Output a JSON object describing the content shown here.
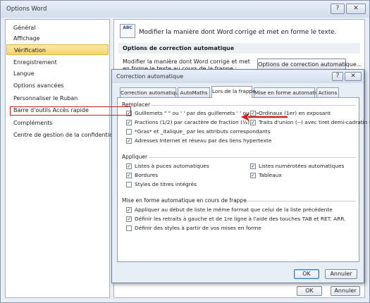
{
  "window": {
    "title": "Options Word",
    "help_glyph": "?",
    "close_glyph": "✕"
  },
  "sidebar": {
    "items": [
      {
        "label": "Général"
      },
      {
        "label": "Affichage"
      },
      {
        "label": "Vérification",
        "selected": true
      },
      {
        "label": "Enregistrement"
      },
      {
        "label": "Langue"
      },
      {
        "label": "Options avancées"
      },
      {
        "label": "Personnaliser le Ruban"
      },
      {
        "label": "Barre d'outils Accès rapide"
      },
      {
        "label": "Compléments"
      },
      {
        "label": "Centre de gestion de la confidentialité"
      }
    ]
  },
  "main": {
    "icon_text": "ABC",
    "heading": "Modifier la manière dont Word corrige et met en forme le texte.",
    "section_title": "Options de correction automatique",
    "description": "Modifier la manière dont Word corrige et met en forme le texte au cours de la frappe :",
    "autocorrect_button": "Options de correction automatique..."
  },
  "footer": {
    "ok": "OK",
    "cancel": "Annuler"
  },
  "dialog": {
    "title": "Correction automatique",
    "help_glyph": "?",
    "close_glyph": "✕",
    "tabs": [
      {
        "label": "Correction automatique"
      },
      {
        "label": "AutoMaths"
      },
      {
        "label": "Lors de la frappe",
        "active": true
      },
      {
        "label": "Mise en forme automatique"
      },
      {
        "label": "Actions"
      }
    ],
    "groups": {
      "replace": {
        "label": "Remplacer",
        "options": [
          {
            "label": "Guillemets \" \" ou ' ' par des guillemets ' ' ou « »",
            "checked": true
          },
          {
            "label": "Ordinaux (1er) en exposant",
            "checked": true
          },
          {
            "label": "Fractions (1/2) par caractère de fraction (½)",
            "checked": true
          },
          {
            "label": "Traits d'union (--) avec tiret demi-cadratin (–)",
            "checked": true
          },
          {
            "label": "*Gras* et _italique_ par les attributs correspondants",
            "checked": false
          },
          {
            "label": "Adresses Internet et réseau par des liens hypertexte",
            "checked": true
          }
        ]
      },
      "apply": {
        "label": "Appliquer",
        "options": [
          {
            "label": "Listes à puces automatiques",
            "checked": true
          },
          {
            "label": "Listes numérotées automatiques",
            "checked": true
          },
          {
            "label": "Bordures",
            "checked": true
          },
          {
            "label": "Tableaux",
            "checked": true
          },
          {
            "label": "Styles de titres intégrés",
            "checked": false
          }
        ]
      },
      "format": {
        "label": "Mise en forme automatique en cours de frappe",
        "options": [
          {
            "label": "Appliquer au début de liste le même format que celui de la liste précédente",
            "checked": true
          },
          {
            "label": "Définir les retraits à gauche et de 1re ligne à l'aide des touches TAB et RET. ARR.",
            "checked": true
          },
          {
            "label": "Définir des styles à partir de vos mises en forme",
            "checked": false
          }
        ]
      }
    },
    "ok": "OK",
    "cancel": "Annuler"
  },
  "annotation": {
    "color": "#d21f1f"
  }
}
